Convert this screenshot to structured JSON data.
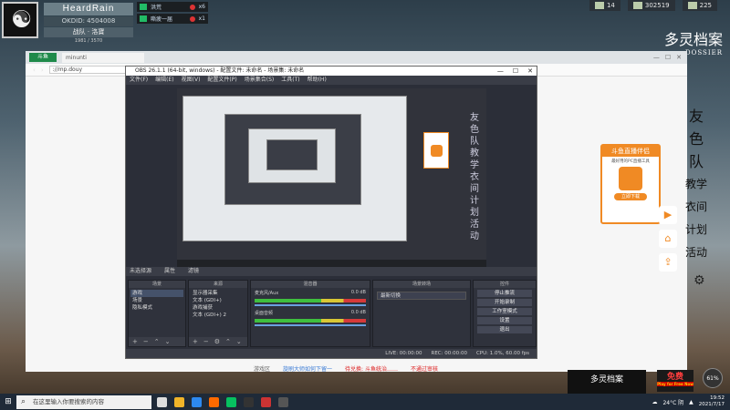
{
  "player": {
    "name": "HeardRain",
    "id": "OKDID: 4504008",
    "rank": "战队 · 洛寶",
    "stat": "1981 / 3570"
  },
  "chat": [
    {
      "text": "洪荒",
      "count": "x6"
    },
    {
      "text": "嘶疲一届",
      "count": "x1"
    }
  ],
  "resources": [
    {
      "value": "14"
    },
    {
      "value": "302519"
    },
    {
      "value": "225"
    }
  ],
  "browser": {
    "logo": "斗鱼",
    "tab": "minunti",
    "address": "://mp.douy",
    "caption_left": "游戏区",
    "caption_link": "旋刷大师如何下留一",
    "caption_right": "待兑换: 斗鱼统治……",
    "caption_warn": "不通过审核"
  },
  "obs": {
    "title": "OBS 26.1.1 (64-bit, windows) - 配置文件: 未命名 - 场景集: 未命名",
    "menu": [
      "文件(F)",
      "编辑(E)",
      "视图(V)",
      "配置文件(P)",
      "场景集合(S)",
      "工具(T)",
      "帮助(H)"
    ],
    "dock_header": [
      "未选择源",
      "属性",
      "滤镜"
    ],
    "scenes_title": "场景",
    "scenes": [
      "游戏",
      "场景",
      "隐私模式"
    ],
    "sources_title": "来源",
    "sources": [
      "显示器采集",
      "文本 (GDI+)",
      "游戏捕获",
      "文本 (GDI+) 2"
    ],
    "mixer_title": "混音器",
    "mixer": [
      {
        "name": "麦克风/Aux",
        "db": "0.0 dB"
      },
      {
        "name": "桌面音频",
        "db": "0.0 dB"
      }
    ],
    "transitions_title": "场景转场",
    "transition": "最新切换",
    "controls_title": "控件",
    "controls": [
      "停止推流",
      "开始录制",
      "工作室模式",
      "设置",
      "退出"
    ],
    "status": [
      "LIVE: 00:00:00",
      "REC: 00:00:00",
      "CPU: 1.0%, 60.00 fps"
    ],
    "preview_chars": [
      "友",
      "色",
      "队",
      "教",
      "学",
      "衣",
      "间",
      "计",
      "划",
      "活",
      "动"
    ]
  },
  "brand": {
    "name": "多灵档案",
    "sub": "DOSSIER"
  },
  "right_chars": [
    "友",
    "色",
    "队",
    "教学",
    "衣间",
    "计划",
    "活动"
  ],
  "ad": {
    "title": "斗鱼直播伴侣",
    "sub": "最好用的PC直播工具",
    "button": "立即下载"
  },
  "bottom": {
    "brand": "多灵档案",
    "promo": "免费",
    "promo_sub": "Play for Free Now",
    "badge": "61%"
  },
  "taskbar": {
    "search_placeholder": "在这里输入你要搜索的内容",
    "weather": "24°C 阴",
    "time": "19:52",
    "date": "2021/7/17"
  }
}
